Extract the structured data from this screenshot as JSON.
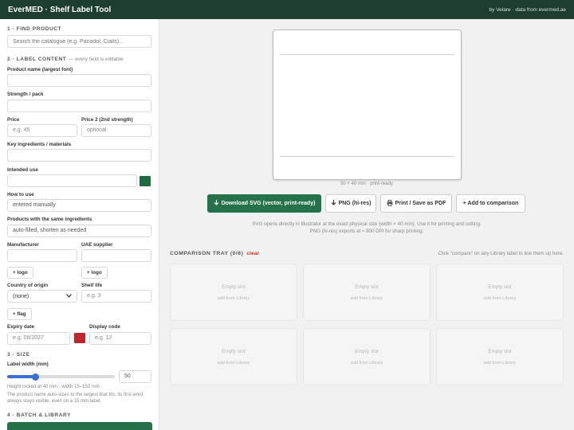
{
  "header": {
    "title": "EverMED · Shelf Label Tool",
    "byline": "by Velare · data from evermed.ae"
  },
  "sidebar": {
    "s1_title": "1 · FIND PRODUCT",
    "search_placeholder": "Search the catalogue (e.g. Panadol, Cialis)...",
    "s2_title": "2 · LABEL CONTENT",
    "s2_note": "— every field is editable",
    "product_name_label": "Product name (largest font)",
    "strength_label": "Strength / pack",
    "price_label": "Price",
    "price_placeholder": "e.g. 45",
    "price2_label": "Price 2 (2nd strength)",
    "price2_placeholder": "optional",
    "ingredients_label": "Key ingredients / materials",
    "intended_use_label": "Intended use",
    "intended_use_color": "#1e6b3f",
    "how_to_use_label": "How to use",
    "how_to_use_value": "entered manually",
    "same_ing_label": "Products with the same ingredients",
    "same_ing_value": "auto-filled, shorten as needed",
    "manufacturer_label": "Manufacturer",
    "supplier_label": "UAE supplier",
    "logo_button": "+ logo",
    "supplier_logo_button": "+ logo",
    "country_label": "Country of origin",
    "country_value": "(none)",
    "shelf_life_label": "Shelf life",
    "shelf_life_placeholder": "e.g. 3",
    "flag_button": "+ flag",
    "expiry_label": "Expiry date",
    "expiry_placeholder": "e.g. 08/2027",
    "expiry_color": "#c0262d",
    "display_code_label": "Display code",
    "display_code_placeholder": "e.g. 12",
    "s3_title": "3 · SIZE",
    "label_width_label": "Label width (mm)",
    "label_width_value": "50",
    "slider_fraction": 0.26,
    "height_note": "Height locked at 40 mm · width 15–150 mm",
    "autosize_note": "The product name auto-sizes to the largest that fits; its first word always stays visible, even on a 15 mm label.",
    "s4_title": "4 · BATCH & LIBRARY"
  },
  "main": {
    "preview_caption": "50 × 40 mm · print-ready",
    "btn_svg": "Download SVG (vector, print-ready)",
    "btn_png": "PNG (hi-res)",
    "btn_print": "Print / Save as PDF",
    "btn_compare": "+ Add to comparison",
    "info_text": "SVG opens directly in Illustrator at the exact physical size (width × 40 mm). Use it for printing and cutting. PNG (hi-res) exports at ≈ 800 DPI for sharp printing.",
    "tray_title": "COMPARISON TRAY (0/6)",
    "tray_clear": "clear",
    "tray_hint": "Click \"compare\" on any Library label to line them up here.",
    "slots": [
      {
        "title": "Empty slot",
        "sub": "add from Library"
      },
      {
        "title": "Empty slot",
        "sub": "add from Library"
      },
      {
        "title": "Empty slot",
        "sub": "add from Library"
      },
      {
        "title": "Empty slot",
        "sub": "add from Library"
      },
      {
        "title": "Empty slot",
        "sub": "add from Library"
      },
      {
        "title": "Empty slot",
        "sub": "add from Library"
      }
    ]
  },
  "icons": {
    "download": "download-icon",
    "print": "printer-icon",
    "chevron": "chevron-down-icon"
  }
}
